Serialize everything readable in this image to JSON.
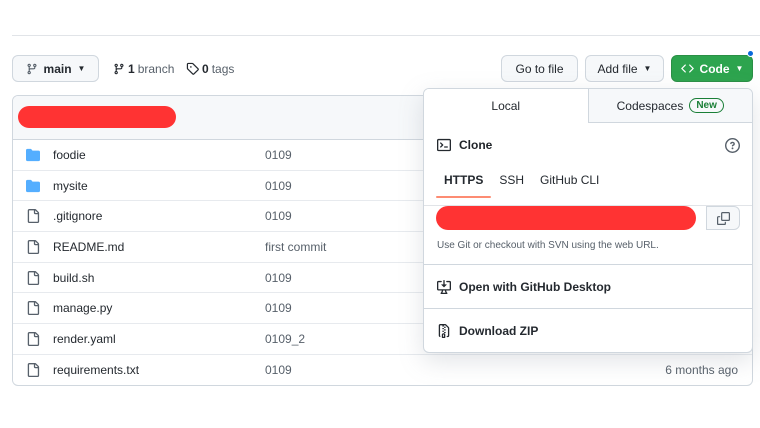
{
  "toolbar": {
    "branch_label": "main",
    "branch_count": "1",
    "branch_word": "branch",
    "tag_count": "0",
    "tag_word": "tags",
    "goto_file": "Go to file",
    "add_file": "Add file",
    "code": "Code"
  },
  "files": [
    {
      "name": "foodie",
      "type": "folder",
      "message": "0109",
      "age": ""
    },
    {
      "name": "mysite",
      "type": "folder",
      "message": "0109",
      "age": ""
    },
    {
      "name": ".gitignore",
      "type": "file",
      "message": "0109",
      "age": ""
    },
    {
      "name": "README.md",
      "type": "file",
      "message": "first commit",
      "age": ""
    },
    {
      "name": "build.sh",
      "type": "file",
      "message": "0109",
      "age": ""
    },
    {
      "name": "manage.py",
      "type": "file",
      "message": "0109",
      "age": ""
    },
    {
      "name": "render.yaml",
      "type": "file",
      "message": "0109_2",
      "age": ""
    },
    {
      "name": "requirements.txt",
      "type": "file",
      "message": "0109",
      "age": "6 months ago"
    }
  ],
  "popover": {
    "tab_local": "Local",
    "tab_codespaces": "Codespaces",
    "new_badge": "New",
    "clone_title": "Clone",
    "protocols": [
      "HTTPS",
      "SSH",
      "GitHub CLI"
    ],
    "hint": "Use Git or checkout with SVN using the web URL.",
    "open_desktop": "Open with GitHub Desktop",
    "download_zip": "Download ZIP"
  },
  "colors": {
    "code_button": "#2da44e",
    "redaction": "#ff3333",
    "active_tab_underline": "#fd8c73",
    "folder_icon": "#54aeff",
    "notification_dot": "#0969da"
  }
}
